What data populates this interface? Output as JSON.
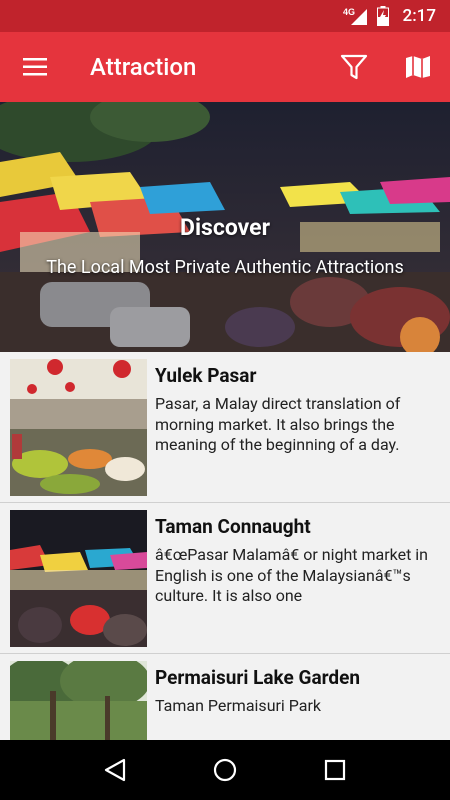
{
  "status_bar": {
    "network_label": "4G",
    "time": "2:17",
    "icons": [
      "signal-icon",
      "battery-charging-icon"
    ]
  },
  "app_bar": {
    "title": "Attraction",
    "icons": [
      "menu-icon",
      "filter-icon",
      "map-icon"
    ],
    "color": "#e5343d"
  },
  "hero": {
    "headline": "Discover",
    "subline": "The Local Most Private Authentic Attractions"
  },
  "attractions": [
    {
      "name": "Yulek Pasar",
      "description": "Pasar, a Malay direct translation of morning market. It also brings the meaning of the beginning of a day."
    },
    {
      "name": "Taman Connaught",
      "description": "â€œPasar Malamâ€ or night market in English is one of the Malaysianâ€™s culture. It is also one"
    },
    {
      "name": "Permaisuri Lake Garden",
      "description": "Taman Permaisuri Park"
    }
  ],
  "nav_bar": {
    "icons": [
      "back-icon",
      "home-icon",
      "recents-icon"
    ]
  }
}
